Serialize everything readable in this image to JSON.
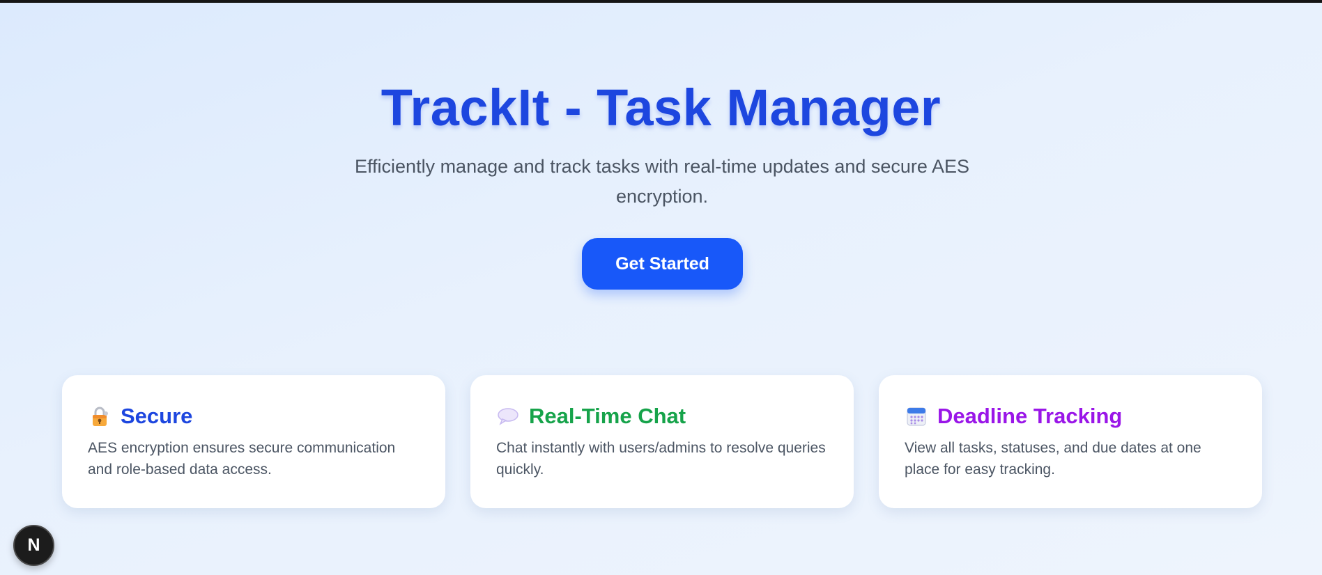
{
  "hero": {
    "title": "TrackIt - Task Manager",
    "subtitle": "Efficiently manage and track tasks with real-time updates and secure AES encryption.",
    "cta_label": "Get Started"
  },
  "features": [
    {
      "icon": "lock-icon",
      "title": "Secure",
      "text": "AES encryption ensures secure communication and role-based data access.",
      "color": "#1d46df"
    },
    {
      "icon": "speech-bubble-icon",
      "title": "Real-Time Chat",
      "text": "Chat instantly with users/admins to resolve queries quickly.",
      "color": "#16a34a"
    },
    {
      "icon": "calendar-icon",
      "title": "Deadline Tracking",
      "text": "View all tasks, statuses, and due dates at one place for easy tracking.",
      "color": "#9a16e8"
    }
  ],
  "badge": {
    "letter": "N",
    "icon": "nextjs-badge-icon"
  },
  "colors": {
    "accent": "#1858f9",
    "title": "#1d46df"
  }
}
